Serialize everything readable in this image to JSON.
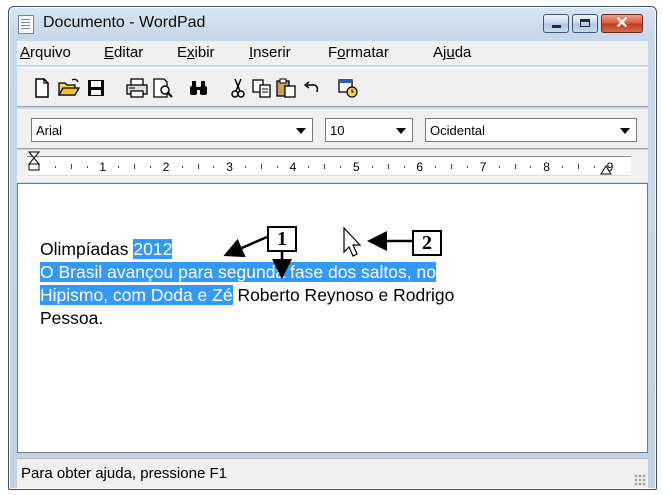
{
  "window": {
    "title": "Documento - WordPad",
    "controls": {
      "minimize": "minimize",
      "maximize": "maximize",
      "close": "✕"
    }
  },
  "menu": {
    "items": [
      {
        "label": "Arquivo",
        "accel": "A",
        "rest": "rquivo"
      },
      {
        "label": "Editar",
        "accel": "E",
        "rest": "ditar"
      },
      {
        "label": "Exibir",
        "accel": "x",
        "pre": "E",
        "rest": "ibir"
      },
      {
        "label": "Inserir",
        "accel": "I",
        "rest": "nserir"
      },
      {
        "label": "Formatar",
        "accel": "o",
        "pre": "F",
        "rest": "rmatar"
      },
      {
        "label": "Ajuda",
        "accel": "u",
        "pre": "Aj",
        "rest": "da"
      }
    ]
  },
  "toolbar": {
    "icons": [
      "new-document-icon",
      "open-folder-icon",
      "save-disk-icon",
      "print-icon",
      "print-preview-icon",
      "find-binoculars-icon",
      "cut-scissors-icon",
      "copy-icon",
      "paste-icon",
      "undo-icon",
      "date-time-icon"
    ]
  },
  "format": {
    "font": "Arial",
    "size": "10",
    "script": "Ocidental"
  },
  "ruler": {
    "numbers": [
      "1",
      "2",
      "3",
      "4",
      "5",
      "6",
      "7",
      "8",
      "9"
    ]
  },
  "document": {
    "line1_plain": "Olimpíadas ",
    "line1_selected": "2012",
    "line2_selected": "O Brasil avançou para segunda fase dos saltos, no",
    "line3_selected": "Hipismo, com Doda e Zé",
    "line3_plain": " Roberto Reynoso e Rodrigo",
    "line4_plain": "Pessoa."
  },
  "status": {
    "text": "Para obter ajuda, pressione F1"
  },
  "annotations": {
    "label1": "1",
    "label2": "2"
  },
  "colors": {
    "selection": "#3399ff",
    "close_button": "#c23a1b"
  }
}
